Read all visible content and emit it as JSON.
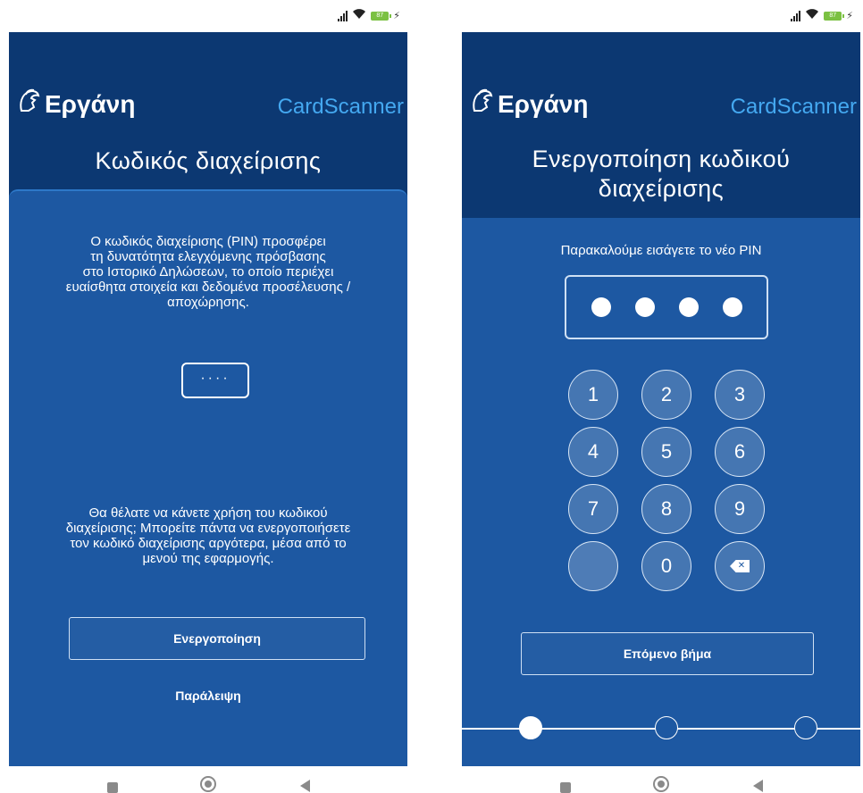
{
  "status": {
    "battery_level": "87"
  },
  "left": {
    "brand": "Εργάνη",
    "app_name": "CardScanner",
    "title": "Κωδικός διαχείρισης",
    "description": [
      "Ο κωδικός διαχείρισης (PIN) προσφέρει",
      "τη δυνατότητα ελεγχόμενης πρόσβασης",
      "στο Ιστορικό Δηλώσεων, το οποίο περιέχει",
      "ευαίσθητα στοιχεία και δεδομένα προσέλευσης /",
      "αποχώρησης."
    ],
    "pin_placeholder": "····",
    "question": [
      "Θα θέλατε να κάνετε χρήση του κωδικού",
      "διαχείρισης; Μπορείτε πάντα να ενεργοποιήσετε",
      "τον κωδικό διαχείρισης αργότερα, μέσα από το",
      "μενού της εφαρμογής."
    ],
    "activate_label": "Ενεργοποίηση",
    "skip_label": "Παράλειψη"
  },
  "right": {
    "brand": "Εργάνη",
    "app_name": "CardScanner",
    "title_line1": "Ενεργοποίηση κωδικού",
    "title_line2": "διαχείρισης",
    "prompt": "Παρακαλούμε εισάγετε το νέο PIN",
    "pin_filled": 4,
    "keys": [
      "1",
      "2",
      "3",
      "4",
      "5",
      "6",
      "7",
      "8",
      "9",
      "",
      "0",
      "⌫"
    ],
    "backspace_glyph": "✕",
    "next_label": "Επόμενο βήμα",
    "steps_total": 3,
    "step_current": 1
  },
  "colors": {
    "header_bg": "#0c3872",
    "card_bg": "#1d58a2",
    "accent": "#44a8f0"
  },
  "icons": [
    "helmet-logo-icon",
    "signal-icon",
    "wifi-icon",
    "battery-icon",
    "charging-icon",
    "backspace-icon",
    "recents-icon",
    "home-icon",
    "back-icon"
  ]
}
